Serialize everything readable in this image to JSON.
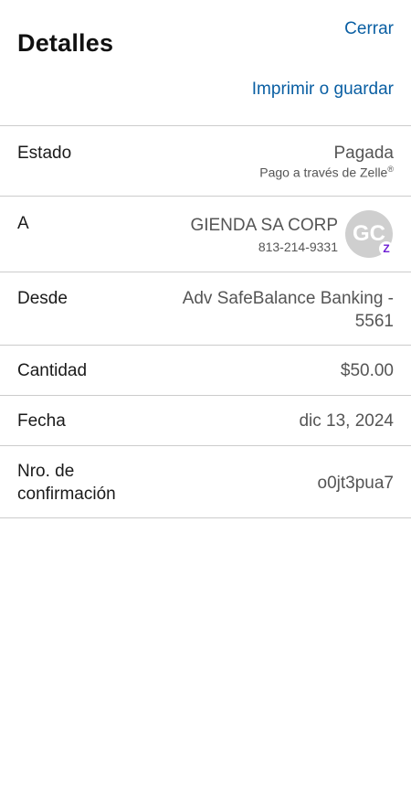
{
  "header": {
    "close_label": "Cerrar",
    "title": "Detalles",
    "print_label": "Imprimir o guardar"
  },
  "details": {
    "status": {
      "label": "Estado",
      "value": "Pagada",
      "sub": "Pago a través de Zelle",
      "sub_mark": "®"
    },
    "to": {
      "label": "A",
      "name": "GIENDA SA CORP",
      "phone": "813-214-9331",
      "avatar_initials": "GC",
      "badge_icon": "zelle-icon",
      "badge_glyph": "Z"
    },
    "from": {
      "label": "Desde",
      "value": "Adv SafeBalance Banking - 5561"
    },
    "amount": {
      "label": "Cantidad",
      "value": "$50.00"
    },
    "date": {
      "label": "Fecha",
      "value": "dic 13, 2024"
    },
    "confirmation": {
      "label": "Nro. de confirmación",
      "value": "o0jt3pua7"
    }
  },
  "colors": {
    "link": "#0a5fa3",
    "divider": "#cccccc",
    "avatar_bg": "#cfcfcf",
    "zelle_purple": "#6d1ed4"
  }
}
